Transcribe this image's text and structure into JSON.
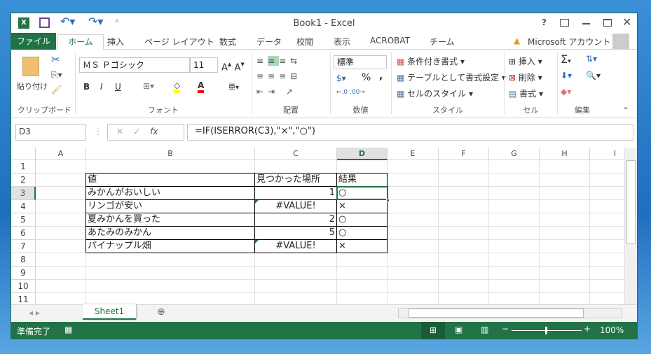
{
  "window": {
    "title": "Book1 - Excel",
    "help": "?",
    "accent": "#217346"
  },
  "qat": {
    "icons": [
      "excel-icon",
      "save-icon",
      "undo-icon",
      "redo-icon",
      "customize-icon"
    ]
  },
  "tabs": [
    "ファイル",
    "ホーム",
    "挿入",
    "ページ レイアウト",
    "数式",
    "データ",
    "校閲",
    "表示",
    "ACROBAT",
    "チーム"
  ],
  "account": "Microsoft アカウント",
  "ribbon": {
    "clipboard": {
      "paste": "貼り付け",
      "label": "クリップボード"
    },
    "font": {
      "name": "ＭＳ Ｐゴシック",
      "size": "11",
      "bold": "B",
      "italic": "I",
      "underline": "U",
      "label": "フォント",
      "fill_color": "#ffff00",
      "font_color": "#ff0000"
    },
    "alignment": {
      "label": "配置"
    },
    "number": {
      "format": "標準",
      "percent": "%",
      "comma": ",",
      "label": "数値"
    },
    "styles": {
      "conditional": "条件付き書式",
      "table": "テーブルとして書式設定",
      "cell": "セルのスタイル",
      "label": "スタイル"
    },
    "cells": {
      "insert": "挿入",
      "delete": "削除",
      "format": "書式",
      "label": "セル"
    },
    "editing": {
      "label": "編集"
    }
  },
  "formula_bar": {
    "name_box": "D3",
    "formula": "=IF(ISERROR(C3),\"×\",\"○\")"
  },
  "columns": [
    "A",
    "B",
    "C",
    "D",
    "E",
    "F",
    "G",
    "H",
    "I"
  ],
  "rows": [
    "1",
    "2",
    "3",
    "4",
    "5",
    "6",
    "7",
    "8",
    "9",
    "10",
    "11"
  ],
  "table": {
    "headers": [
      "値",
      "見つかった場所",
      "結果"
    ],
    "rows": [
      [
        "みかんがおいしい",
        "1",
        "○"
      ],
      [
        "リンゴが安い",
        "#VALUE!",
        "×"
      ],
      [
        "夏みかんを買った",
        "2",
        "○"
      ],
      [
        "あたみのみかん",
        "5",
        "○"
      ],
      [
        "パイナップル畑",
        "#VALUE!",
        "×"
      ]
    ]
  },
  "sheets": [
    "Sheet1"
  ],
  "status": {
    "ready": "準備完了",
    "zoom": "100%"
  }
}
